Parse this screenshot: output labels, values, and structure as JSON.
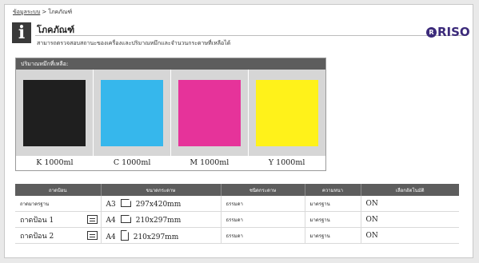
{
  "breadcrumb": {
    "link": "ข้อมูลระบบ",
    "sep": ">",
    "current": "โภคภัณฑ์"
  },
  "header": {
    "title": "โภคภัณฑ์",
    "subtitle": "สามารถตรวจสอบสถานะของเครื่องและปริมาณหมึกและจำนวนกระดาษที่เหลือได้",
    "info_icon": "i",
    "logo_text": "RISO",
    "logo_mark": "R"
  },
  "ink": {
    "header": "ปริมาณหมึกที่เหลือ:",
    "cartridges": [
      {
        "label": "K 1000ml",
        "color": "#1f1f1f"
      },
      {
        "label": "C 1000ml",
        "color": "#36b7ec"
      },
      {
        "label": "M 1000ml",
        "color": "#e6339a"
      },
      {
        "label": "Y 1000ml",
        "color": "#fff21a"
      }
    ]
  },
  "trays": {
    "columns": [
      "ถาดป้อน",
      "ขนาดกระดาษ",
      "ชนิดกระดาษ",
      "ความหนา",
      "เลือกอัตโนมัติ"
    ],
    "rows": [
      {
        "name": "ถาดมาตรฐาน",
        "size_code": "A3",
        "orientation": "landscape",
        "size": "297x420mm",
        "type": "ธรรมดา",
        "thickness": "มาตรฐาน",
        "auto": "ON",
        "tray_icon": false
      },
      {
        "name": "ถาดป้อน 1",
        "size_code": "A4",
        "orientation": "landscape",
        "size": "210x297mm",
        "type": "ธรรมดา",
        "thickness": "มาตรฐาน",
        "auto": "ON",
        "tray_icon": true
      },
      {
        "name": "ถาดป้อน 2",
        "size_code": "A4",
        "orientation": "portrait",
        "size": "210x297mm",
        "type": "ธรรมดา",
        "thickness": "มาตรฐาน",
        "auto": "ON",
        "tray_icon": true
      }
    ]
  }
}
